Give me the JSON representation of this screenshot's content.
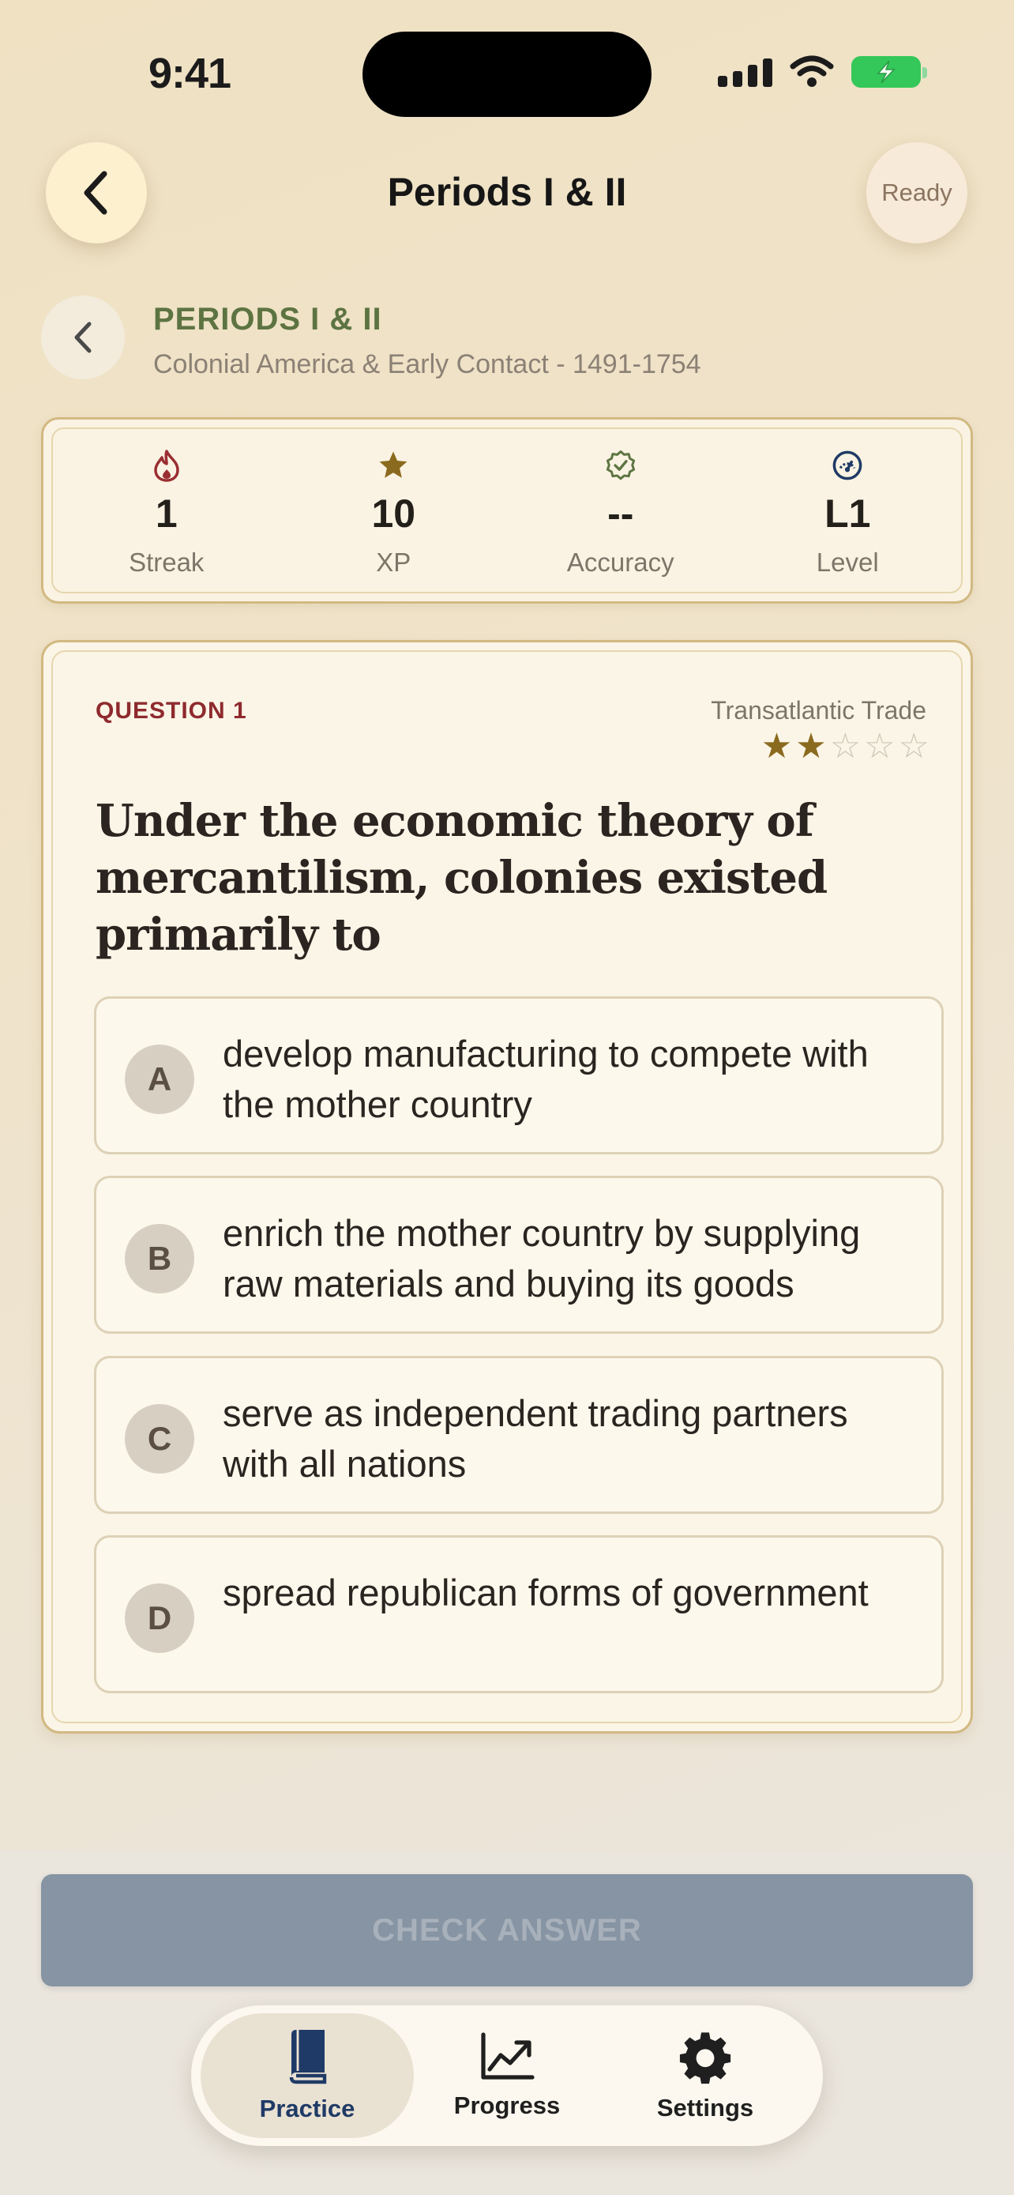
{
  "status_bar": {
    "time": "9:41"
  },
  "header": {
    "title": "Periods I & II",
    "ready_label": "Ready"
  },
  "section": {
    "title": "PERIODS I & II",
    "subtitle": "Colonial America & Early Contact - 1491-1754"
  },
  "stats": [
    {
      "icon": "flame-icon",
      "value": "1",
      "label": "Streak"
    },
    {
      "icon": "star-icon",
      "value": "10",
      "label": "XP"
    },
    {
      "icon": "check-badge-icon",
      "value": "--",
      "label": "Accuracy"
    },
    {
      "icon": "gauge-icon",
      "value": "L1",
      "label": "Level"
    }
  ],
  "question": {
    "label": "QUESTION 1",
    "topic": "Transatlantic Trade",
    "difficulty": {
      "filled": 2,
      "total": 5
    },
    "text": "Under the economic theory of mercantilism, colonies existed primarily to",
    "options": [
      {
        "letter": "A",
        "text": "develop manufacturing to compete with the mother country"
      },
      {
        "letter": "B",
        "text": "enrich the mother country by supplying raw materials and buying its goods"
      },
      {
        "letter": "C",
        "text": "serve as independent trading partners with all nations"
      },
      {
        "letter": "D",
        "text": "spread republican forms of government"
      }
    ]
  },
  "check_button": {
    "label": "CHECK ANSWER"
  },
  "tabs": [
    {
      "label": "Practice",
      "icon": "book-icon",
      "active": true
    },
    {
      "label": "Progress",
      "icon": "chart-icon",
      "active": false
    },
    {
      "label": "Settings",
      "icon": "gear-icon",
      "active": false
    }
  ],
  "colors": {
    "accent_green": "#5d7442",
    "question_label_red": "#8e2a2e",
    "star_gold": "#8a6a1e",
    "active_tab_blue": "#1f3a66",
    "check_button": "#8694a3"
  }
}
